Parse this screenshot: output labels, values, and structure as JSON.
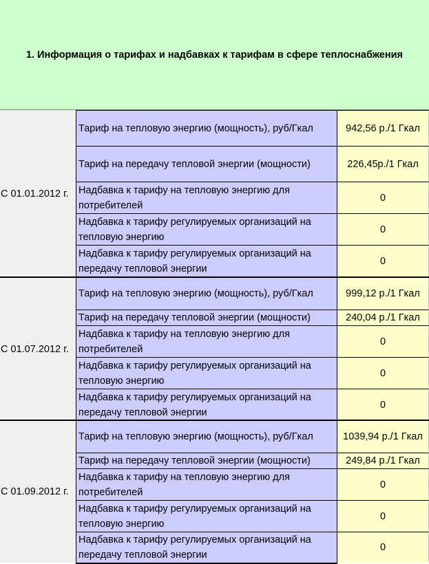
{
  "title": "1. Информация о тарифах и надбавках к тарифам в сфере теплоснабжения",
  "groups": [
    {
      "date": "С 01.01.2012 г.",
      "rows": [
        {
          "label": "Тариф на тепловую энергию (мощность), руб/Гкал",
          "value": "942,56 р./1 Гкал"
        },
        {
          "label": "Тариф на передачу тепловой энергии (мощности)",
          "value": "226,45р./1 Гкал"
        },
        {
          "label": "Надбавка к тарифу на тепловую энергию для потребителей",
          "value": "0"
        },
        {
          "label": "Надбавка к тарифу регулируемых организаций на тепловую энергию",
          "value": "0"
        },
        {
          "label": "Надбавка к тарифу регулируемых организаций на передачу тепловой энергии",
          "value": "0"
        }
      ]
    },
    {
      "date": "С 01.07.2012 г.",
      "rows": [
        {
          "label": "Тариф на тепловую энергию (мощность), руб/Гкал",
          "value": "999,12 р./1 Гкал"
        },
        {
          "label": "Тариф на передачу тепловой энергии (мощности)",
          "value": "240,04  р./1 Гкал"
        },
        {
          "label": "Надбавка к тарифу на тепловую энергию для потребителей",
          "value": "0"
        },
        {
          "label": "Надбавка к тарифу регулируемых организаций на тепловую энергию",
          "value": "0"
        },
        {
          "label": "Надбавка к тарифу регулируемых организаций на передачу тепловой энергии",
          "value": "0"
        }
      ]
    },
    {
      "date": "С 01.09.2012 г.",
      "rows": [
        {
          "label": "Тариф на тепловую энергию (мощность), руб/Гкал",
          "value": "1039,94 р./1 Гкал"
        },
        {
          "label": "Тариф на передачу тепловой энергии (мощности)",
          "value": "249,84  р./1 Гкал"
        },
        {
          "label": "Надбавка к тарифу на тепловую энергию для потребителей",
          "value": "0"
        },
        {
          "label": "Надбавка к тарифу регулируемых организаций на тепловую энергию",
          "value": "0"
        },
        {
          "label": "Надбавка к тарифу регулируемых организаций на передачу тепловой энергии",
          "value": "0"
        }
      ]
    }
  ]
}
